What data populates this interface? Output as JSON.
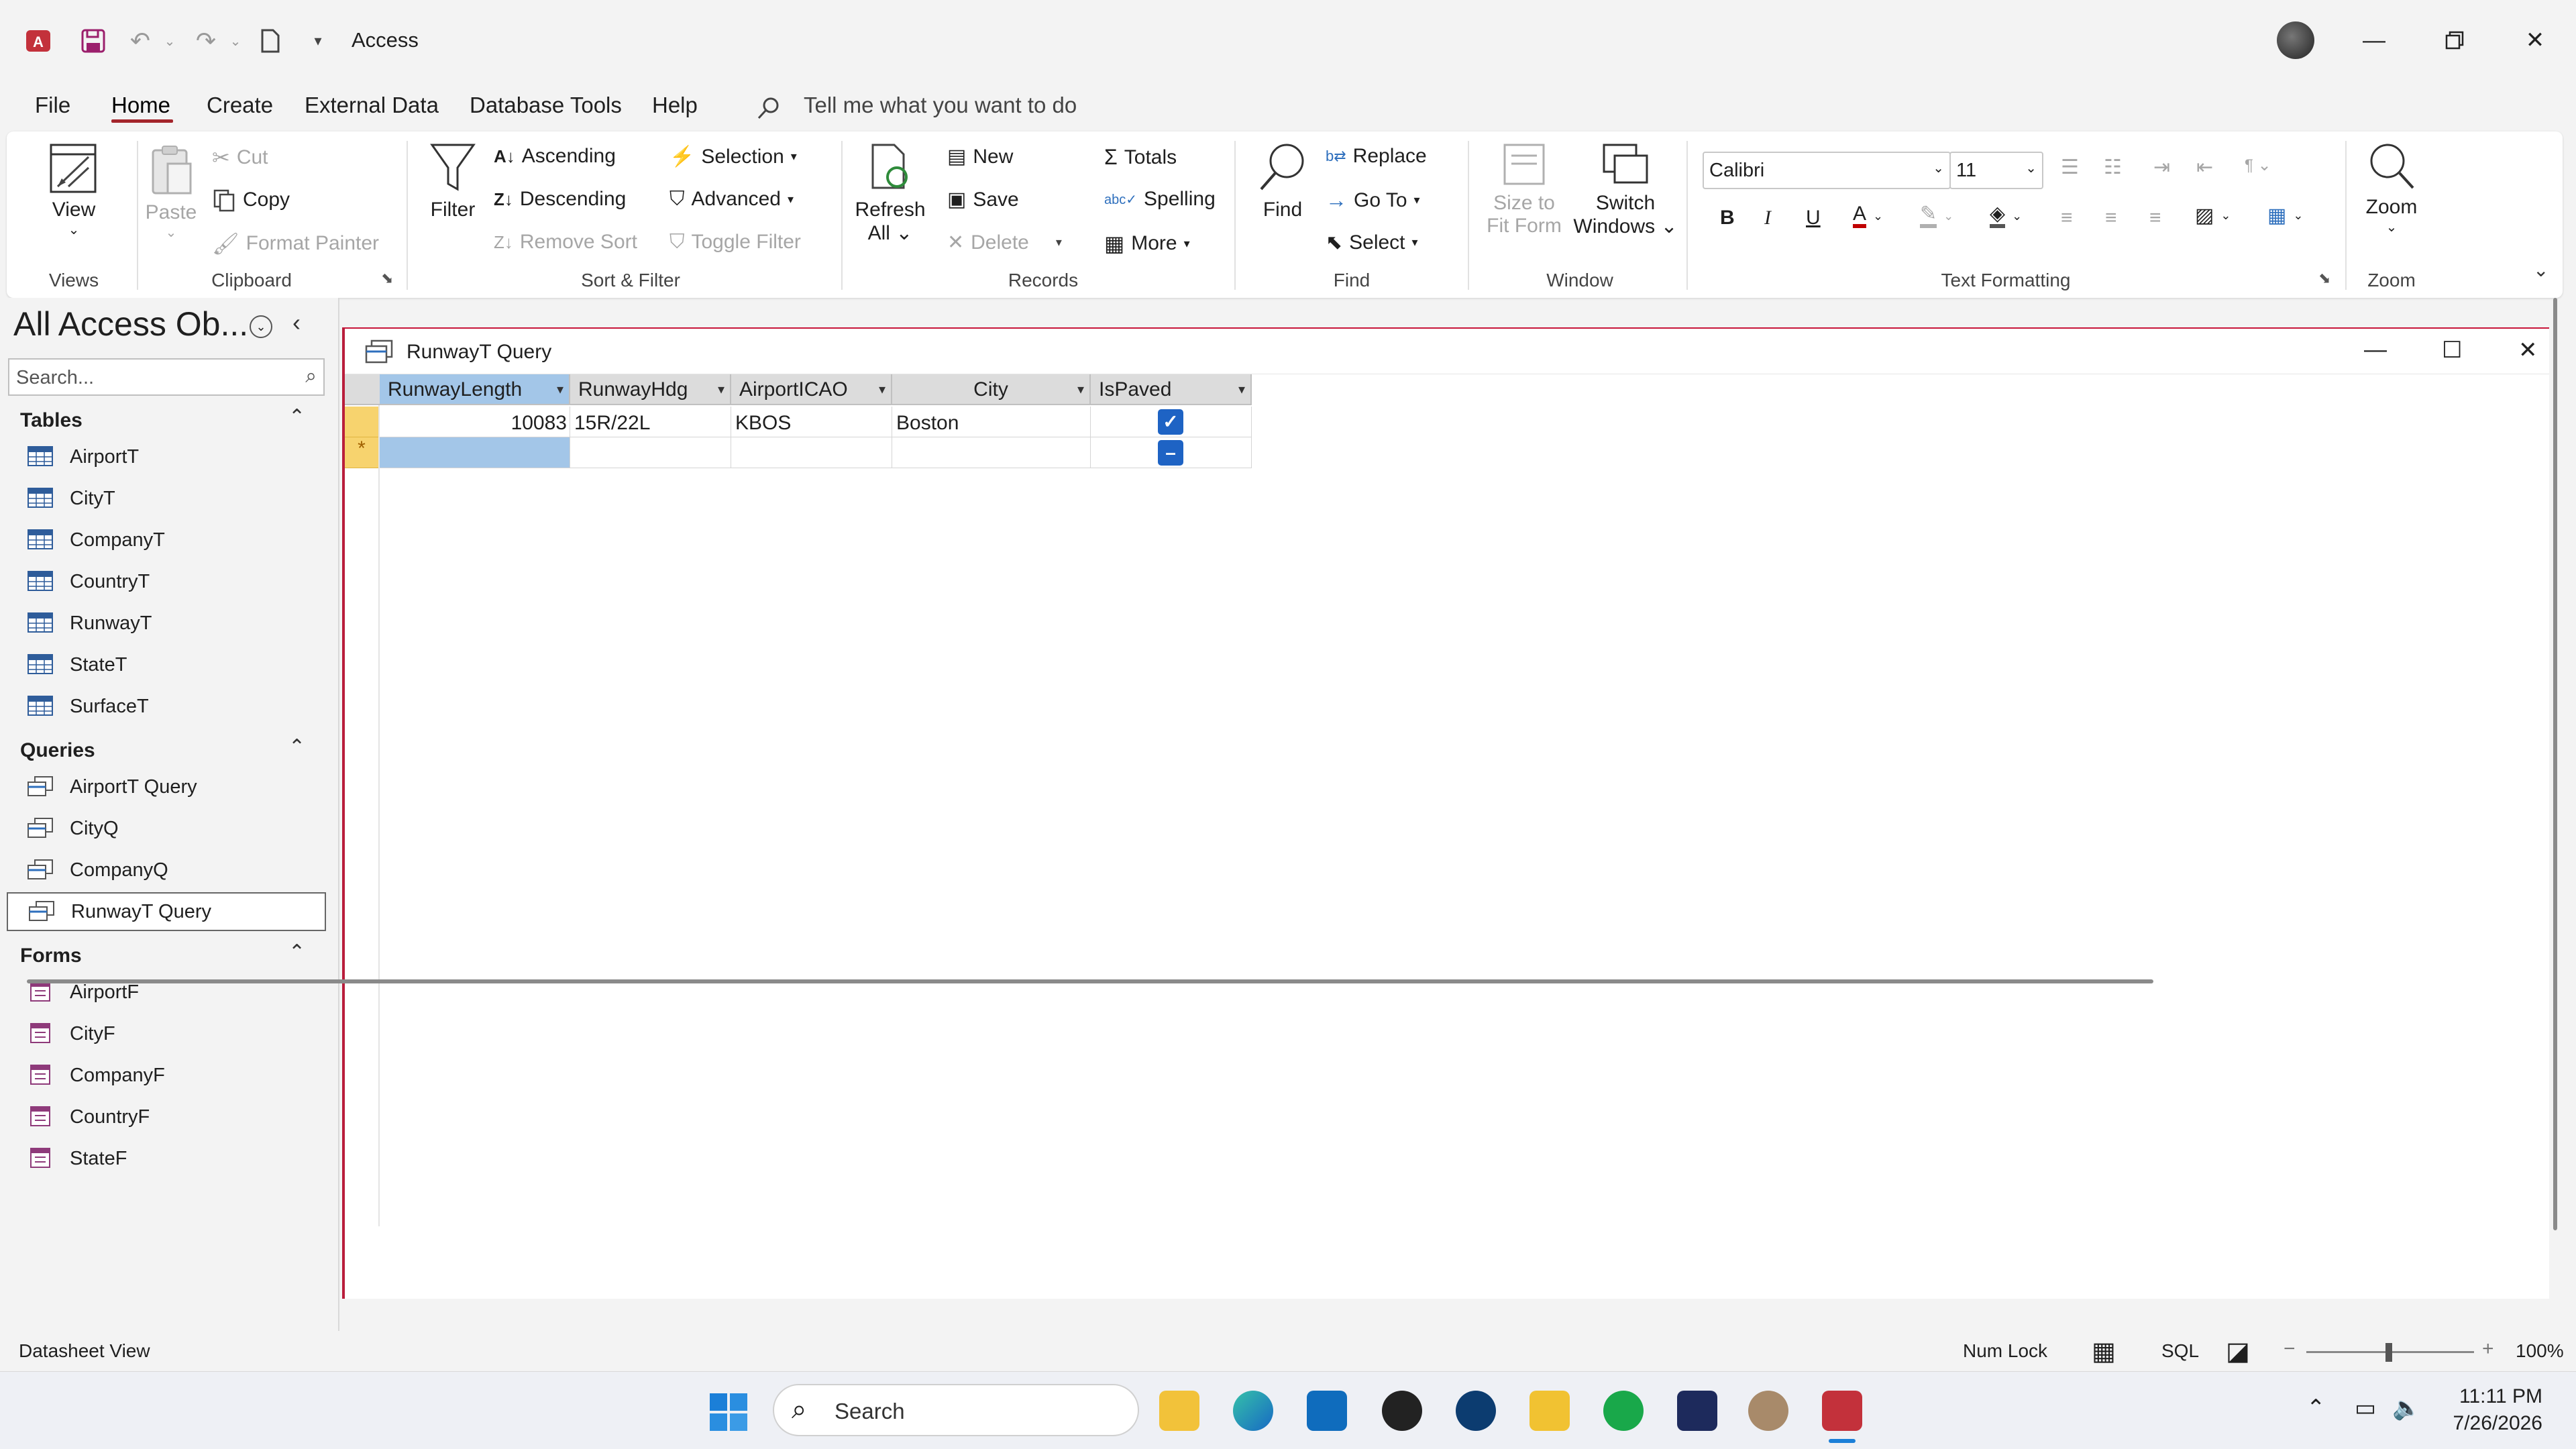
{
  "titlebar": {
    "app_title": "Access"
  },
  "menu": {
    "tabs": [
      "File",
      "Home",
      "Create",
      "External Data",
      "Database Tools",
      "Help"
    ],
    "tell_me": "Tell me what you want to do"
  },
  "ribbon": {
    "views": {
      "view": "View",
      "group": "Views"
    },
    "clipboard": {
      "paste": "Paste",
      "cut": "Cut",
      "copy": "Copy",
      "format_painter": "Format Painter",
      "group": "Clipboard"
    },
    "sort_filter": {
      "filter": "Filter",
      "ascending": "Ascending",
      "descending": "Descending",
      "remove_sort": "Remove Sort",
      "selection": "Selection",
      "advanced": "Advanced",
      "toggle_filter": "Toggle Filter",
      "group": "Sort & Filter"
    },
    "records": {
      "refresh": "Refresh",
      "refresh_all": "All",
      "new": "New",
      "save": "Save",
      "delete": "Delete",
      "totals": "Totals",
      "spelling": "Spelling",
      "more": "More",
      "group": "Records"
    },
    "find": {
      "find": "Find",
      "replace": "Replace",
      "goto": "Go To",
      "select": "Select",
      "group": "Find"
    },
    "window": {
      "size_to": "Size to",
      "fit_form": "Fit Form",
      "switch": "Switch",
      "windows": "Windows",
      "group": "Window"
    },
    "text_formatting": {
      "font": "Calibri",
      "size": "11",
      "bold": "B",
      "italic": "I",
      "underline": "U",
      "group": "Text Formatting"
    },
    "zoom": {
      "zoom": "Zoom",
      "group": "Zoom"
    },
    "accent_color": "#a4262c"
  },
  "nav": {
    "title": "All Access Ob...",
    "search_placeholder": "Search...",
    "sections": [
      {
        "name": "Tables",
        "items": [
          "AirportT",
          "CityT",
          "CompanyT",
          "CountryT",
          "RunwayT",
          "StateT",
          "SurfaceT"
        ]
      },
      {
        "name": "Queries",
        "items": [
          "AirportT Query",
          "CityQ",
          "CompanyQ",
          "RunwayT Query"
        ]
      },
      {
        "name": "Forms",
        "items": [
          "AirportF",
          "CityF",
          "CompanyF",
          "CountryF",
          "StateF"
        ]
      }
    ],
    "selected_item": "RunwayT Query"
  },
  "document": {
    "title": "RunwayT Query",
    "columns": [
      "RunwayLength",
      "RunwayHdg",
      "AirportICAO",
      "City",
      "IsPaved"
    ],
    "rows": [
      {
        "RunwayLength": "10083",
        "RunwayHdg": "15R/22L",
        "AirportICAO": "KBOS",
        "City": "Boston",
        "IsPaved": true
      }
    ],
    "new_row_marker": "*"
  },
  "status": {
    "view": "Datasheet View",
    "num_lock": "Num Lock",
    "sql": "SQL",
    "zoom": "100%"
  },
  "taskbar": {
    "search": "Search",
    "time": "11:11 PM",
    "date": "7/26/2026"
  }
}
